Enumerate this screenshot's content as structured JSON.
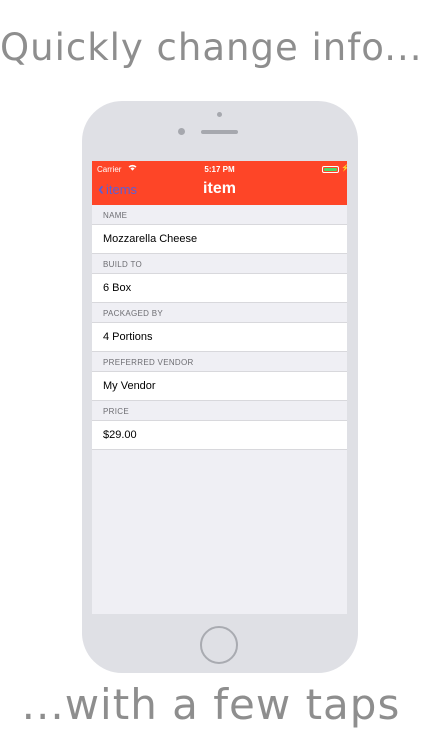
{
  "headline_top": "Quickly change info...",
  "headline_bottom": "...with a few taps",
  "status_bar": {
    "carrier": "Carrier",
    "wifi_icon": "wifi-icon",
    "time": "5:17 PM",
    "battery_color": "#4cd964"
  },
  "nav": {
    "back_label": "items",
    "title": "item",
    "bar_color": "#fe4527",
    "back_color": "#5b5fd6"
  },
  "fields": [
    {
      "header": "NAME",
      "value": "Mozzarella Cheese"
    },
    {
      "header": "BUILD TO",
      "value": "6 Box"
    },
    {
      "header": "PACKAGED BY",
      "value": "4 Portions"
    },
    {
      "header": "PREFERRED VENDOR",
      "value": "My Vendor"
    },
    {
      "header": "PRICE",
      "value": "$29.00"
    }
  ]
}
